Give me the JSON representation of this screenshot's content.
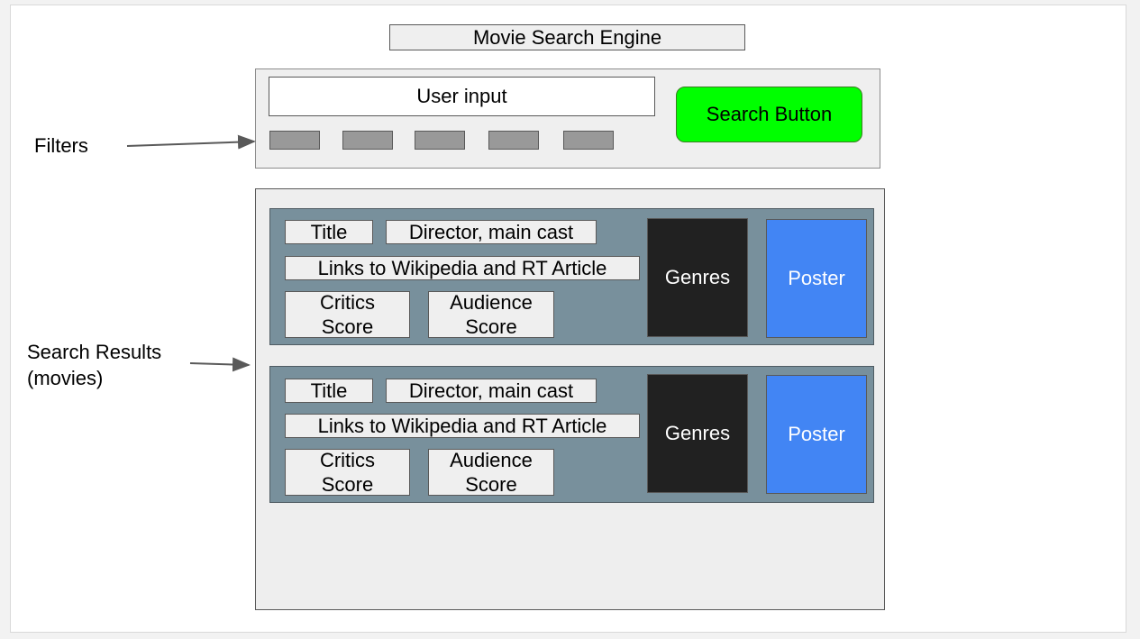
{
  "title": "Movie Search Engine",
  "search": {
    "input_label": "User input",
    "button_label": "Search Button",
    "filter_count": 5
  },
  "annotations": {
    "filters": "Filters",
    "results_line1": "Search Results",
    "results_line2": "(movies)"
  },
  "results": [
    {
      "title": "Title",
      "director_cast": "Director, main cast",
      "links": "Links to Wikipedia and RT Article",
      "critics_line1": "Critics",
      "critics_line2": "Score",
      "audience_line1": "Audience",
      "audience_line2": "Score",
      "genres": "Genres",
      "poster": "Poster"
    },
    {
      "title": "Title",
      "director_cast": "Director, main cast",
      "links": "Links to Wikipedia and RT Article",
      "critics_line1": "Critics",
      "critics_line2": "Score",
      "audience_line1": "Audience",
      "audience_line2": "Score",
      "genres": "Genres",
      "poster": "Poster"
    }
  ],
  "colors": {
    "search_button": "#00ff00",
    "card": "#78909c",
    "genres": "#212121",
    "poster": "#4285f4"
  }
}
